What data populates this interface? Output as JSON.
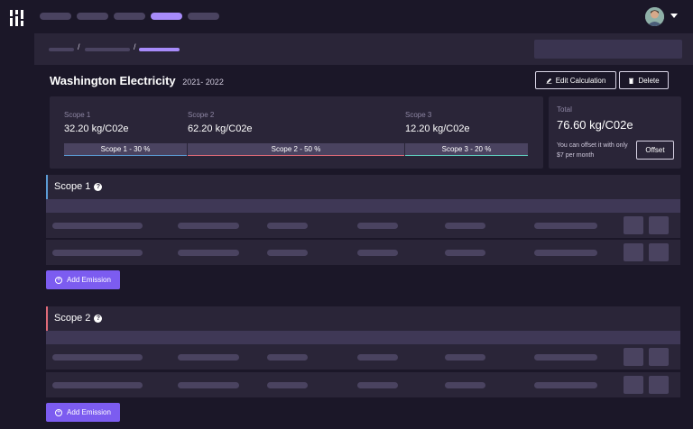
{
  "title": "Washington Electricity",
  "year": "2021- 2022",
  "actions": {
    "edit_label": "Edit Calculation",
    "delete_label": "Delete"
  },
  "scopes": [
    {
      "label": "Scope 1",
      "value": "32.20 kg/C02e",
      "bar_label": "Scope 1 - 30 %",
      "share": 0.3,
      "color": "#5b9bd5"
    },
    {
      "label": "Scope 2",
      "value": "62.20 kg/C02e",
      "bar_label": "Scope 2 - 50 %",
      "share": 0.5,
      "color": "#e06a78"
    },
    {
      "label": "Scope 3",
      "value": "12.20 kg/C02e",
      "bar_label": "Scope 3 - 20 %",
      "share": 0.2,
      "color": "#5fd0c0"
    }
  ],
  "total": {
    "label": "Total",
    "value": "76.60 kg/C02e",
    "offset_text": "You can offset it with only $7 per month",
    "offset_label": "Offset"
  },
  "sections": [
    {
      "title": "Scope 1",
      "accent": "#5b9bd5",
      "add_label": "Add Emission"
    },
    {
      "title": "Scope 2",
      "accent": "#e06a78",
      "add_label": "Add Emission"
    }
  ],
  "icons": {
    "help": "?",
    "edit": "pencil-icon",
    "delete": "trash-icon",
    "add": "plus-circle-icon"
  },
  "colors": {
    "accent": "#7c5cf0",
    "active_nav": "#a78bfa",
    "background": "#1b1728",
    "panel": "#2a2538"
  }
}
